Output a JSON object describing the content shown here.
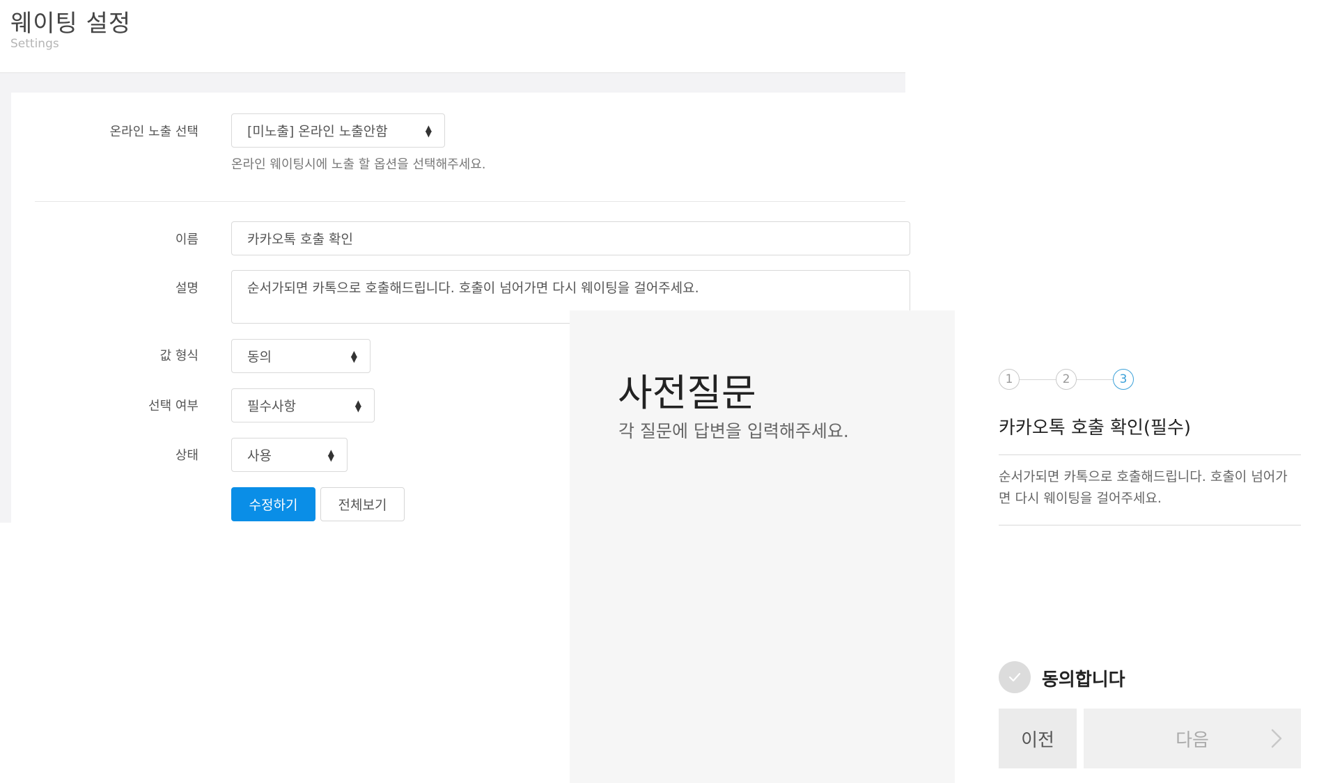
{
  "header": {
    "title": "웨이팅 설정",
    "subtitle": "Settings"
  },
  "form": {
    "online_exposure": {
      "label": "온라인 노출 선택",
      "value": "[미노출] 온라인 노출안함",
      "help": "온라인 웨이팅시에 노출 할 옵션을 선택해주세요."
    },
    "name": {
      "label": "이름",
      "value": "카카오톡 호출 확인"
    },
    "description": {
      "label": "설명",
      "value": "순서가되면 카톡으로 호출해드립니다. 호출이 넘어가면 다시 웨이팅을 걸어주세요."
    },
    "value_format": {
      "label": "값 형식",
      "value": "동의"
    },
    "required": {
      "label": "선택 여부",
      "value": "필수사항"
    },
    "status": {
      "label": "상태",
      "value": "사용"
    },
    "edit_button": "수정하기",
    "view_all_button": "전체보기"
  },
  "preview": {
    "title": "사전질문",
    "subtitle": "각 질문에 답변을 입력해주세요."
  },
  "question_card": {
    "steps": [
      "1",
      "2",
      "3"
    ],
    "active_step": 3,
    "title": "카카오톡 호출 확인(필수)",
    "description": "순서가되면 카톡으로 호출해드립니다. 호출이 넘어가면 다시 웨이팅을 걸어주세요.",
    "agree_label": "동의합니다",
    "prev_button": "이전",
    "next_button": "다음"
  },
  "colors": {
    "primary_button": "#0a8ee7",
    "active_step": "#3aa0d8",
    "panel_background": "#f3f3f5"
  }
}
